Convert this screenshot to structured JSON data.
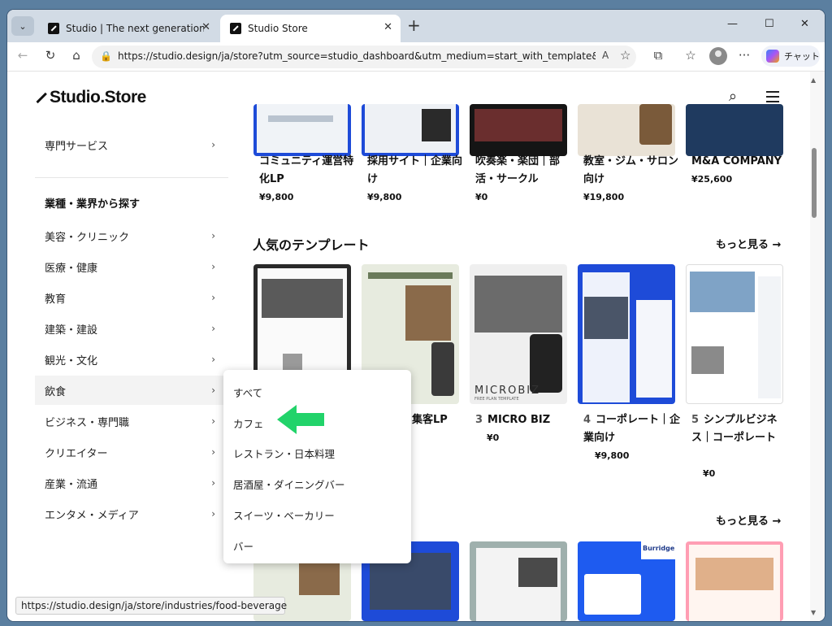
{
  "browser": {
    "tabs": [
      {
        "title": "Studio | The next generation desig"
      },
      {
        "title": "Studio Store"
      }
    ],
    "url": "https://studio.design/ja/store?utm_source=studio_dashboard&utm_medium=start_with_template&u...",
    "copilot_label": "チャット",
    "status_url": "https://studio.design/ja/store/industries/food-beverage"
  },
  "header": {
    "logo": "Studio.Store"
  },
  "sidebar": {
    "top_item": "専門サービス",
    "heading": "業種・業界から探す",
    "items": [
      "美容・クリニック",
      "医療・健康",
      "教育",
      "建築・建設",
      "観光・文化",
      "飲食",
      "ビジネス・専門職",
      "クリエイター",
      "産業・流通",
      "エンタメ・メディア"
    ]
  },
  "top_cards": [
    {
      "title": "コミュニティ運営特化LP",
      "price": "¥9,800"
    },
    {
      "title": "採用サイト｜企業向け",
      "price": "¥9,800"
    },
    {
      "title": "吹奏楽・楽団｜部活・サークル",
      "price": "¥0"
    },
    {
      "title": "教室・ジム・サロン向け",
      "price": "¥19,800"
    },
    {
      "title": "M&A COMPANY",
      "price": "¥25,600"
    }
  ],
  "popular": {
    "heading": "人気のテンプレート",
    "more": "もっと見る →",
    "cards": [
      {
        "num": "",
        "title": "",
        "price": ""
      },
      {
        "num": "",
        "title": "ナルスタ集客LP",
        "price": ""
      },
      {
        "num": "3",
        "title": "MICRO BIZ",
        "price": "¥0"
      },
      {
        "num": "4",
        "title": "コーポレート｜企業向け",
        "price": "¥9,800"
      },
      {
        "num": "5",
        "title": "シンプルビジネス｜コーポレート",
        "price": "¥0"
      }
    ]
  },
  "more2": "もっと見る →",
  "dropdown": {
    "items": [
      "すべて",
      "カフェ",
      "レストラン・日本料理",
      "居酒屋・ダイニングバー",
      "スイーツ・ベーカリー",
      "バー"
    ]
  },
  "thumb_text": {
    "microbiz": "MICROBIZ",
    "microbiz_sub": "FREE PLAN TEMPLATE",
    "burridge": "Burridge"
  },
  "colors": {
    "accent_arrow": "#22d36a",
    "highlight": "#f3f3f3"
  }
}
